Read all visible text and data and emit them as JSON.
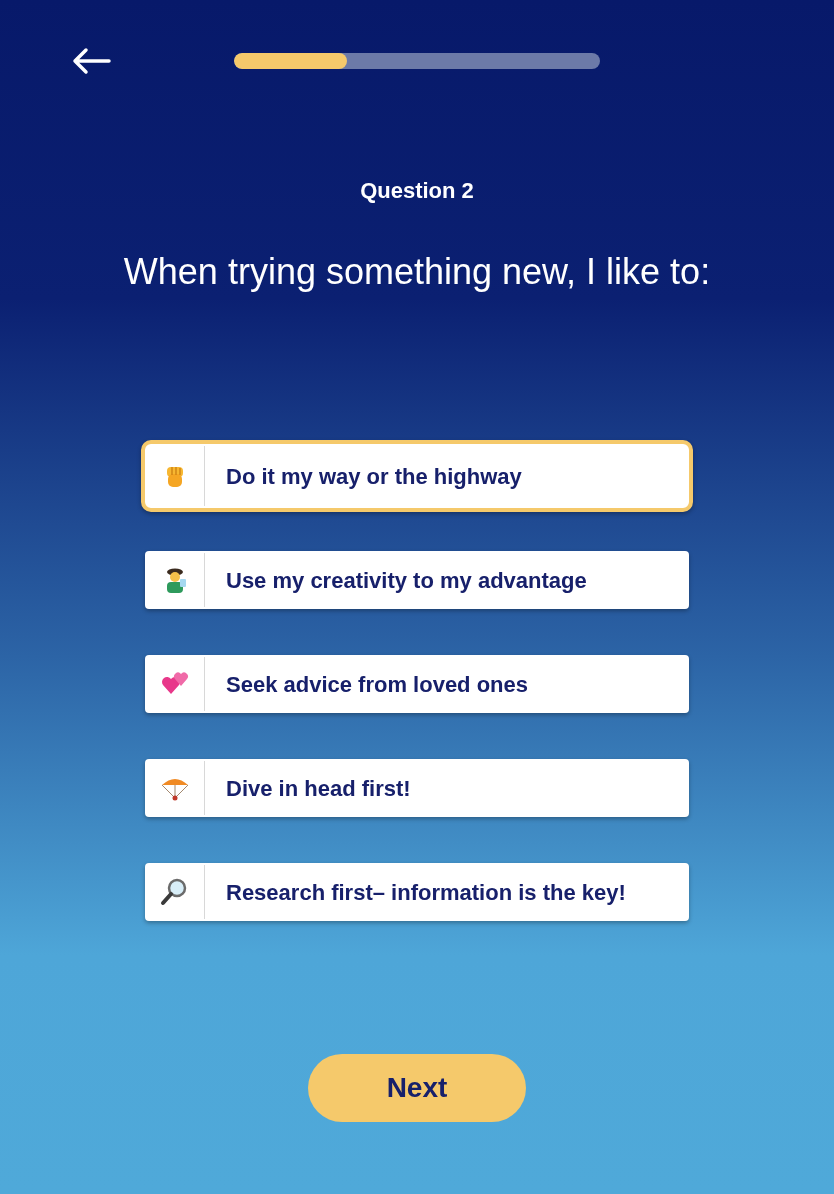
{
  "progress": {
    "level": 0.31
  },
  "question_label": "Question 2",
  "question": "When trying something new, I like to:",
  "options": [
    {
      "kind": "fist",
      "label": "Do it my way or the highway",
      "selected": true
    },
    {
      "kind": "artist",
      "label": "Use my creativity to my advantage",
      "selected": false
    },
    {
      "kind": "hearts",
      "label": "Seek advice from loved ones",
      "selected": false
    },
    {
      "kind": "parachute",
      "label": "Dive in head first!",
      "selected": false
    },
    {
      "kind": "magnifier",
      "label": "Research first– information is the key!",
      "selected": false
    }
  ],
  "next_button": "Next"
}
